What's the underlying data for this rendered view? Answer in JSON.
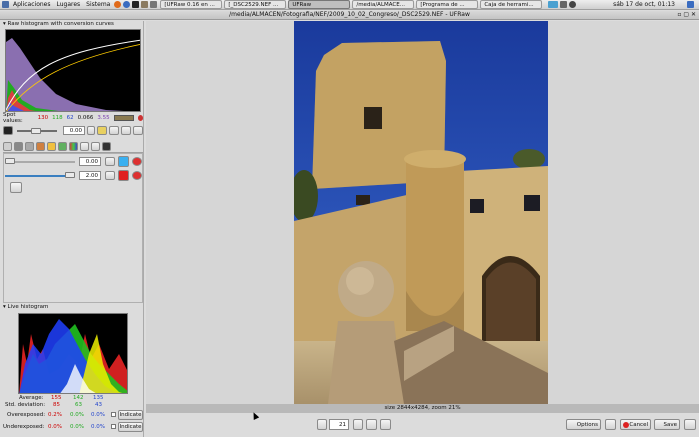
{
  "topbar": {
    "menus": [
      "Aplicaciones",
      "Lugares",
      "Sistema"
    ],
    "tasks": [
      {
        "label": "[UFRaw 0.16 en ...",
        "active": false
      },
      {
        "label": "[_DSC2529.NEF ...",
        "active": false
      },
      {
        "label": "UFRaw",
        "active": true
      },
      {
        "label": "/media/ALMACE...",
        "active": false
      },
      {
        "label": "[Programa de ...",
        "active": false
      },
      {
        "label": "Caja de herrami...",
        "active": false
      }
    ],
    "clock": "sáb 17 de oct, 01:13"
  },
  "window": {
    "title": "/media/ALMACEN/Fotografia/NEF/2009_10_02_Congreso/_DSC2529.NEF - UFRaw"
  },
  "raw_histogram": {
    "header": "Raw histogram with conversion curves",
    "spot_label": "Spot values:",
    "spot_values": [
      "130",
      "118",
      "62",
      "0.066",
      "3.55"
    ],
    "spot_colors": [
      "#cc0000",
      "#22aa22",
      "#2244cc",
      "#000000",
      "#7a3fb0"
    ]
  },
  "exposure": {
    "value": "0.00"
  },
  "wb": {
    "value1": "0.00",
    "value2": "2.00"
  },
  "live_histogram": {
    "header": "Live histogram",
    "average_label": "Average:",
    "average": [
      "155",
      "142",
      "135"
    ],
    "std_label": "Std. deviation:",
    "std": [
      "85",
      "63",
      "43"
    ],
    "over_label": "Overexposed:",
    "over": [
      "0.2%",
      "0.0%",
      "0.0%"
    ],
    "under_label": "Underexposed:",
    "under": [
      "0.0%",
      "0.0%",
      "0.0%"
    ],
    "indicate": "Indicate"
  },
  "status": "size 2844x4284, zoom 21%",
  "zoom": {
    "value": "21"
  },
  "buttons": {
    "options": "Options",
    "cancel": "Cancel",
    "save": "Save"
  },
  "colors": {
    "sky": "#1d3fa3",
    "stone": "#c8a96e"
  }
}
